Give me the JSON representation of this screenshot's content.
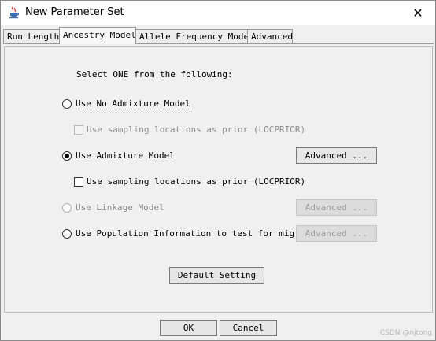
{
  "window": {
    "title": "New Parameter Set",
    "close_glyph": "✕"
  },
  "tabs": [
    {
      "label": "Run Length",
      "active": false
    },
    {
      "label": "Ancestry Model",
      "active": true
    },
    {
      "label": "Allele Frequency Model",
      "active": false
    },
    {
      "label": "Advanced",
      "active": false
    }
  ],
  "panel": {
    "instruction": "Select ONE from the following:",
    "options": {
      "no_admixture": {
        "label": "Use No Admixture Model",
        "selected": false,
        "enabled": true
      },
      "no_admixture_locprior": {
        "label": "Use sampling locations as prior (LOCPRIOR)",
        "checked": false,
        "enabled": false
      },
      "admixture": {
        "label": "Use Admixture Model",
        "selected": true,
        "enabled": true,
        "advanced_label": "Advanced ..."
      },
      "admixture_locprior": {
        "label": "Use sampling locations as prior (LOCPRIOR)",
        "checked": false,
        "enabled": true
      },
      "linkage": {
        "label": "Use Linkage Model",
        "selected": false,
        "enabled": false,
        "advanced_label": "Advanced ..."
      },
      "popinfo": {
        "label": "Use Population Information to test for mig...",
        "selected": false,
        "enabled": true,
        "advanced_label": "Advanced ..."
      }
    },
    "default_button": "Default Setting"
  },
  "footer": {
    "ok_label": "OK",
    "cancel_label": "Cancel"
  },
  "watermark": "CSDN @njtong",
  "icons": {
    "app": "java-cup-icon",
    "close": "close-icon"
  }
}
